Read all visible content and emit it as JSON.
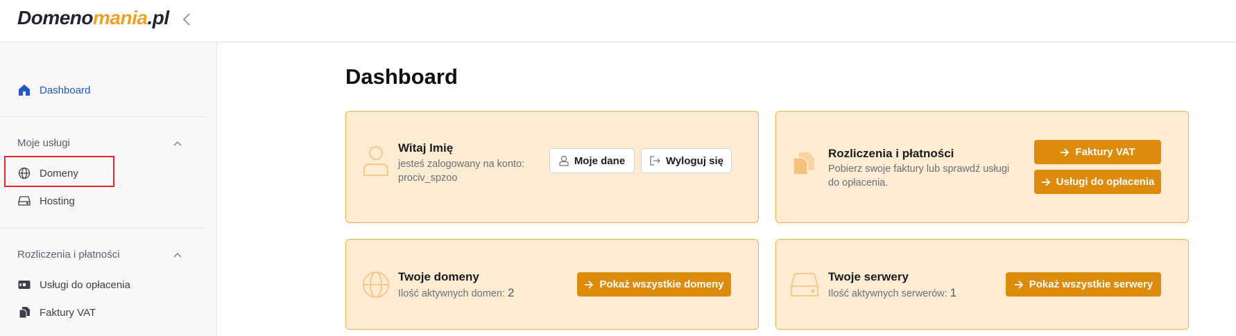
{
  "brand": {
    "logo_part1": "Domeno",
    "logo_part2": "mania",
    "logo_part3": ".pl"
  },
  "sidebar": {
    "dashboard_label": "Dashboard",
    "section1_title": "Moje usługi",
    "domeny_label": "Domeny",
    "hosting_label": "Hosting",
    "section2_title": "Rozliczenia i płatności",
    "uslugi_label": "Usługi do opłacenia",
    "faktury_label": "Faktury VAT"
  },
  "main": {
    "title": "Dashboard",
    "welcome": {
      "title": "Witaj Imię",
      "line1": "jesteś zalogowany na konto:",
      "line2": "prociv_spzoo",
      "btn_profile": "Moje dane",
      "btn_logout": "Wyloguj się"
    },
    "billing": {
      "title": "Rozliczenia i płatności",
      "line1": "Pobierz swoje faktury lub sprawdź usługi",
      "line2": "do opłacenia.",
      "btn_invoices": "Faktury VAT",
      "btn_unpaid": "Usługi do opłacenia"
    },
    "domains": {
      "title": "Twoje domeny",
      "label": "Ilość aktywnych domen:",
      "count": "2",
      "btn": "Pokaż wszystkie domeny"
    },
    "servers": {
      "title": "Twoje serwery",
      "label": "Ilość aktywnych serwerów:",
      "count": "1",
      "btn": "Pokaż wszystkie serwery"
    }
  },
  "colors": {
    "accent": "#dc8b0b",
    "card_bg": "#fdebd2",
    "card_border": "#f1b155",
    "active_nav": "#2257c9",
    "highlight": "#e5242c"
  }
}
